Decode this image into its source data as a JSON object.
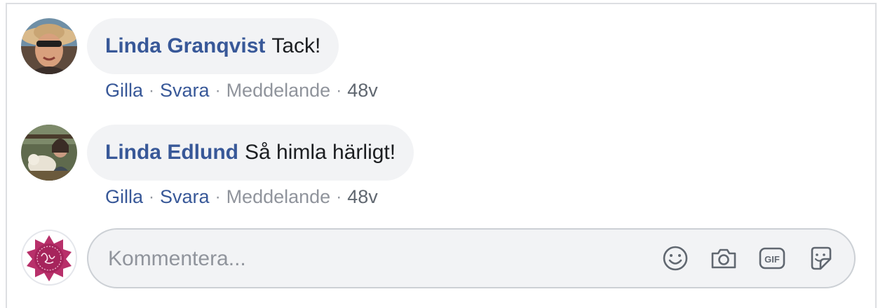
{
  "comments": [
    {
      "author": "Linda Granqvist",
      "text": "Tack!",
      "actions": {
        "like": "Gilla",
        "reply": "Svara",
        "message": "Meddelande",
        "time": "48v"
      }
    },
    {
      "author": "Linda Edlund",
      "text": "Så himla härligt!",
      "actions": {
        "like": "Gilla",
        "reply": "Svara",
        "message": "Meddelande",
        "time": "48v"
      }
    }
  ],
  "separator": "·",
  "composer": {
    "placeholder": "Kommentera...",
    "tools": [
      "emoji-icon",
      "camera-icon",
      "gif-icon",
      "sticker-icon"
    ]
  },
  "colors": {
    "author_link": "#385898",
    "bubble_bg": "#f2f3f5",
    "muted_text": "#90949c",
    "border": "#ccd0d5"
  }
}
